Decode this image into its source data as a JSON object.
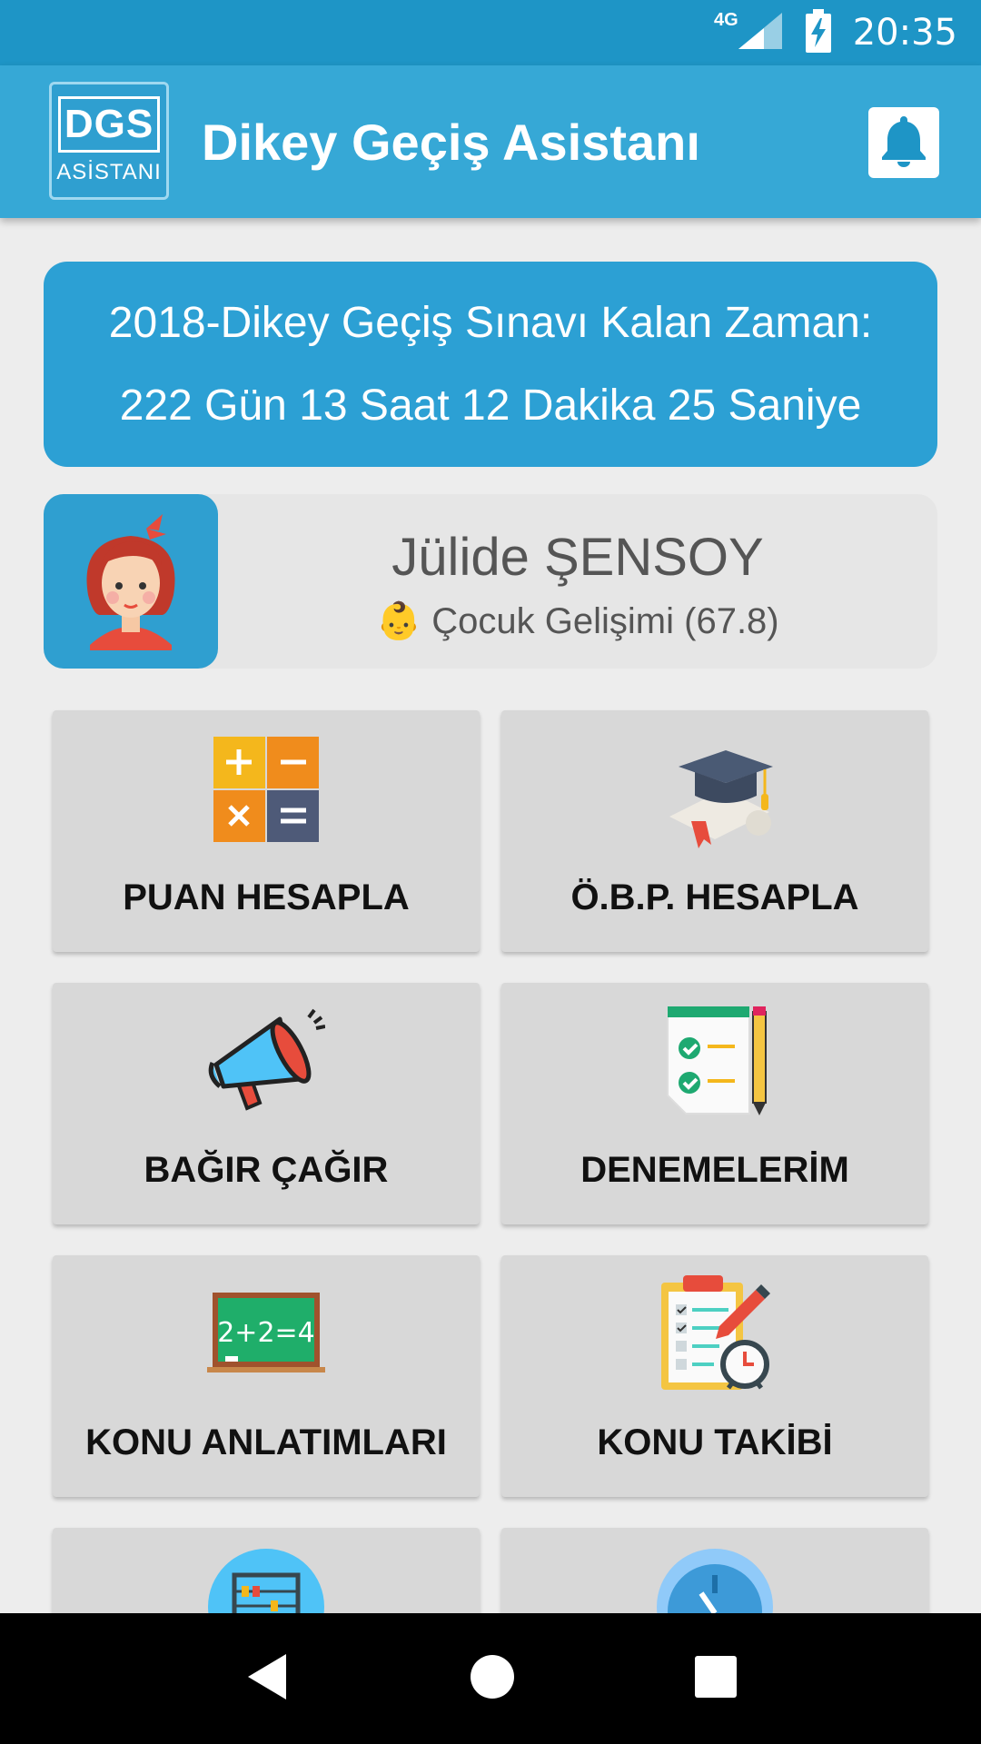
{
  "status_bar": {
    "network": "4G",
    "time": "20:35"
  },
  "app_bar": {
    "logo_top": "DGS",
    "logo_bottom": "ASİSTANI",
    "title": "Dikey Geçiş Asistanı"
  },
  "countdown": {
    "line1": "2018-Dikey Geçiş Sınavı Kalan Zaman:",
    "line2": "222 Gün 13 Saat 12 Dakika 25 Saniye"
  },
  "profile": {
    "name": "Jülide ŞENSOY",
    "department": "👶 Çocuk Gelişimi (67.8)"
  },
  "menu": {
    "items": [
      {
        "label": "PUAN HESAPLA",
        "icon": "calculator-icon"
      },
      {
        "label": "Ö.B.P. HESAPLA",
        "icon": "graduation-cap-icon"
      },
      {
        "label": "BAĞIR ÇAĞIR",
        "icon": "megaphone-icon"
      },
      {
        "label": "DENEMELERİM",
        "icon": "checklist-icon"
      },
      {
        "label": "KONU ANLATIMLARI",
        "icon": "chalkboard-icon"
      },
      {
        "label": "KONU TAKİBİ",
        "icon": "clipboard-timer-icon"
      },
      {
        "label": "",
        "icon": "abacus-icon"
      },
      {
        "label": "",
        "icon": "stopwatch-icon"
      }
    ]
  },
  "colors": {
    "status_bar": "#1e95c6",
    "app_bar": "#36a8d6",
    "countdown_bg": "#2ca0d4",
    "tile_bg": "#d8d8d8"
  }
}
